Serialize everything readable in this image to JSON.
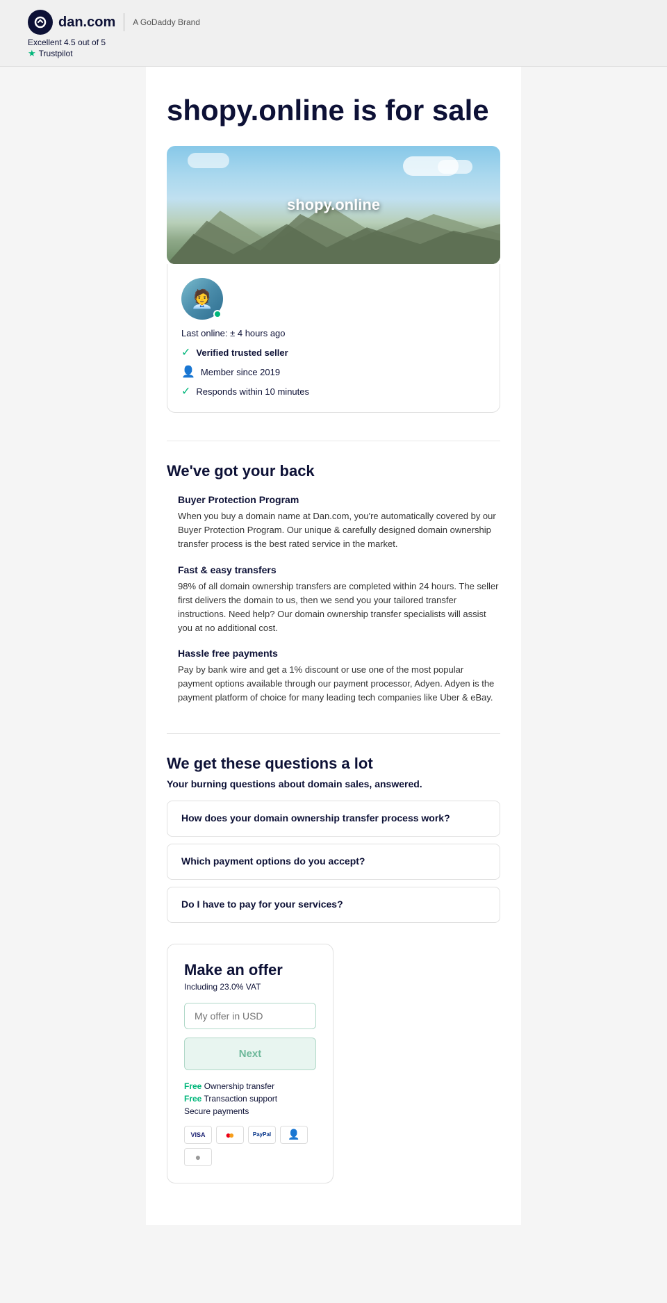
{
  "header": {
    "logo_text": "dan.com",
    "brand_label": "A GoDaddy Brand",
    "rating_text": "Excellent 4.5 out of 5",
    "trustpilot_label": "Trustpilot"
  },
  "page": {
    "title": "shopy.online is for sale",
    "domain_name": "shopy.online"
  },
  "seller": {
    "last_online": "Last online: ± 4 hours ago",
    "verified_label": "Verified trusted seller",
    "member_since": "Member since 2019",
    "response_time": "Responds within 10 minutes"
  },
  "protection_section": {
    "title": "We've got your back",
    "features": [
      {
        "title": "Buyer Protection Program",
        "description": "When you buy a domain name at Dan.com, you're automatically covered by our Buyer Protection Program. Our unique & carefully designed domain ownership transfer process is the best rated service in the market."
      },
      {
        "title": "Fast & easy transfers",
        "description": "98% of all domain ownership transfers are completed within 24 hours. The seller first delivers the domain to us, then we send you your tailored transfer instructions. Need help? Our domain ownership transfer specialists will assist you at no additional cost."
      },
      {
        "title": "Hassle free payments",
        "description": "Pay by bank wire and get a 1% discount or use one of the most popular payment options available through our payment processor, Adyen. Adyen is the payment platform of choice for many leading tech companies like Uber & eBay."
      }
    ]
  },
  "faq_section": {
    "title": "We get these questions a lot",
    "subtitle": "Your burning questions about domain sales, answered.",
    "questions": [
      "How does your domain ownership transfer process work?",
      "Which payment options do you accept?",
      "Do I have to pay for your services?"
    ]
  },
  "offer_section": {
    "title": "Make an offer",
    "vat_label": "Including 23.0% VAT",
    "input_placeholder": "My offer in USD",
    "button_label": "Next",
    "features": [
      {
        "free_label": "Free",
        "text": "Ownership transfer"
      },
      {
        "free_label": "Free",
        "text": "Transaction support"
      },
      {
        "text": "Secure payments",
        "free_label": ""
      }
    ],
    "payment_methods": [
      "VISA",
      "●●",
      "PayPal",
      "👤",
      "●"
    ]
  }
}
